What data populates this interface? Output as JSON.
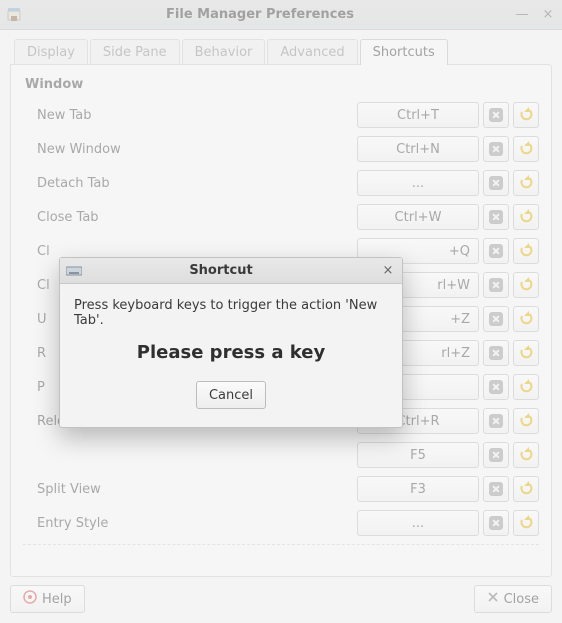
{
  "window": {
    "title": "File Manager Preferences"
  },
  "tabs": [
    {
      "label": "Display",
      "active": false
    },
    {
      "label": "Side Pane",
      "active": false
    },
    {
      "label": "Behavior",
      "active": false
    },
    {
      "label": "Advanced",
      "active": false
    },
    {
      "label": "Shortcuts",
      "active": true
    }
  ],
  "section": {
    "title": "Window"
  },
  "rows": [
    {
      "label": "New Tab",
      "accel": "Ctrl+T"
    },
    {
      "label": "New Window",
      "accel": "Ctrl+N"
    },
    {
      "label": "Detach Tab",
      "accel": "..."
    },
    {
      "label": "Close Tab",
      "accel": "Ctrl+W"
    },
    {
      "label_partial": "Cl",
      "accel_partial": "+Q"
    },
    {
      "label_partial": "Cl",
      "accel_partial": "rl+W"
    },
    {
      "label_partial": "U",
      "accel_partial": "+Z"
    },
    {
      "label_partial": "R",
      "accel_partial": "rl+Z"
    },
    {
      "label_partial": "P",
      "accel": ""
    },
    {
      "label": "Reload",
      "accel": "Ctrl+R"
    },
    {
      "label": "",
      "accel": "F5"
    },
    {
      "label": "Split View",
      "accel": "F3"
    },
    {
      "label": "Entry Style",
      "accel": "..."
    }
  ],
  "footer": {
    "help_label": "Help",
    "close_label": "Close"
  },
  "dialog": {
    "title": "Shortcut",
    "instruction": "Press keyboard keys to trigger the action 'New Tab'.",
    "prompt": "Please press a key",
    "cancel_label": "Cancel"
  },
  "icons": {
    "clear": "clear-icon",
    "reset": "reset-icon"
  },
  "colors": {
    "reset_arrow": "#e0b000"
  }
}
